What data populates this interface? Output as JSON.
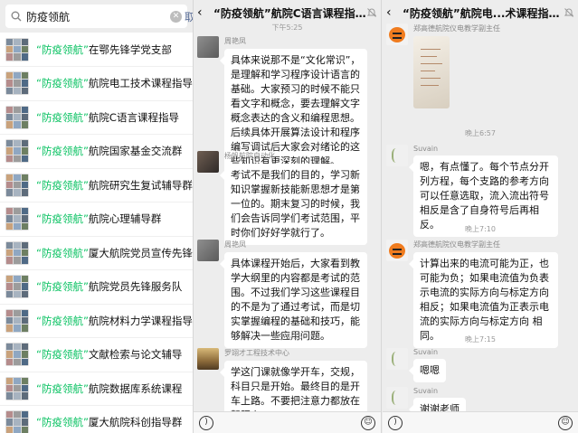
{
  "search": {
    "query": "防疫领航",
    "clear_glyph": "✕",
    "cutoff_text": "取",
    "keyword": "“防疫领航”",
    "results": [
      {
        "rest": "在鄂先锋学党支部"
      },
      {
        "rest": "航院电工技术课程指导"
      },
      {
        "rest": "航院C语言课程指导"
      },
      {
        "rest": "航院国家基金交流群"
      },
      {
        "rest": "航院研究生复试辅导群"
      },
      {
        "rest": "航院心理辅导群"
      },
      {
        "rest": "厦大航院党员宣传先锋"
      },
      {
        "rest": "航院党员先锋服务队"
      },
      {
        "rest": "航院材料力学课程指导"
      },
      {
        "rest": "文献检索与论文辅导"
      },
      {
        "rest": "航院数据库系统课程"
      },
      {
        "rest": "厦大航院科创指导群"
      }
    ]
  },
  "chat1": {
    "back": "‹",
    "title": "“防疫领航”航院C语言课程指导(360)",
    "time1": "下午5:25",
    "time2": "下午5:35",
    "messages": [
      {
        "sender": "周艳凤",
        "text": "具体来说那不是“文化常识”，是理解和学习程序设计语言的基础。大家预习的时候不能只看文字和概念，要去理解文字概念表达的含义和编程思想。后续具体开展算法设计和程序编写调试后大家会对绪论的这些知识有更深刻的理解。"
      },
      {
        "sender": "杨帆航院自动化",
        "text": "考试不是我们的目的，学习新知识掌握新技能新思想才是第一位的。期末复习的时候，我们会告诉同学们考试范围，平时你们好好学就行了。"
      },
      {
        "sender": "周艳凤",
        "text": "具体课程开始后，大家看到教学大纲里的内容都是考试的范围。不过我们学习这些课程目的不是为了通过考试，而是切实掌握编程的基础和技巧，能够解决一些应用问题。"
      },
      {
        "sender": "罗翊才工程技术中心",
        "text": "学这门课就像学开车，交规，科目只是开始。最终目的是开车上路。不要把注意力都放在驾照上。"
      }
    ]
  },
  "chat2": {
    "back": "‹",
    "title": "“防疫领航”航院电...术课程指导(361)",
    "sender_teacher": "郑高德航院仪电教学副主任",
    "sender_student": "Suvain",
    "time1": "晚上6:57",
    "time2": "晚上7:10",
    "time3": "晚上7:15",
    "messages": [
      {
        "text": "嗯，有点懂了。每个节点分开列方程，每个支路的参考方向可以任意选取，流入流出符号相反是含了自身符号后再相反。"
      },
      {
        "text": "计算出来的电流可能为正，也可能为负；如果电流值为负表示电流的实际方向与标定方向 相反；如果电流值为正表示电流的实际方向与标定方向 相同。"
      },
      {
        "text": "嗯嗯"
      },
      {
        "text": "谢谢老师"
      }
    ]
  },
  "icons": {
    "voice": "voice-icon",
    "emoji": "emoji-icon",
    "mute": "mute-icon",
    "search": "search-icon"
  },
  "colors": {
    "keyword": "#07c160",
    "bg": "#ededed",
    "bubble": "#ffffff"
  }
}
